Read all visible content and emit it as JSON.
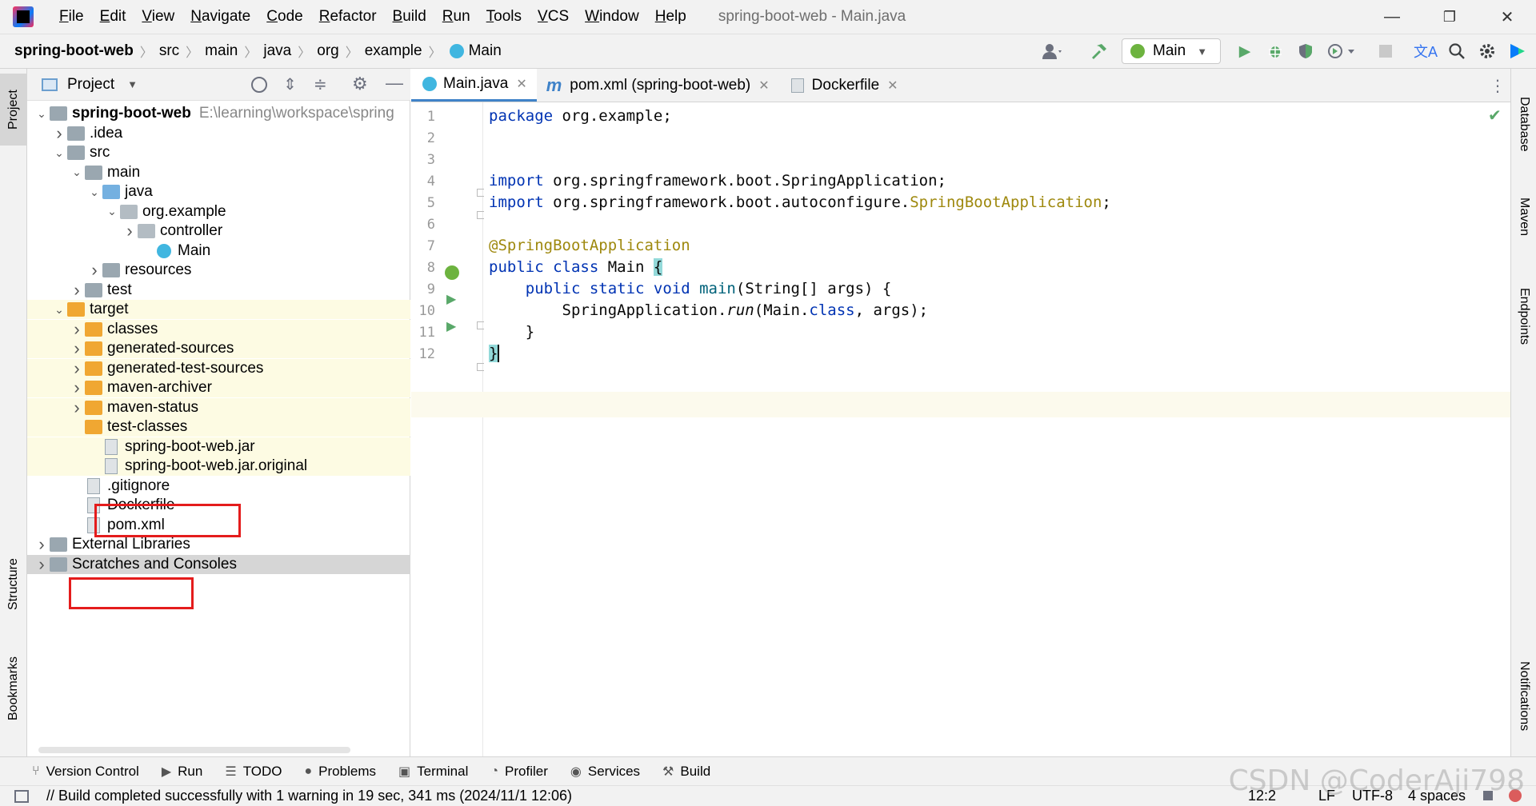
{
  "window": {
    "title": "spring-boot-web - Main.java",
    "minimize": "—",
    "restore": "❐",
    "close": "✕"
  },
  "menu": [
    "File",
    "Edit",
    "View",
    "Navigate",
    "Code",
    "Refactor",
    "Build",
    "Run",
    "Tools",
    "VCS",
    "Window",
    "Help"
  ],
  "breadcrumbs": [
    "spring-boot-web",
    "src",
    "main",
    "java",
    "org",
    "example",
    "Main"
  ],
  "run_config": {
    "label": "Main"
  },
  "project_panel": {
    "title": "Project"
  },
  "tree": [
    {
      "label": "spring-boot-web",
      "path": "E:\\learning\\workspace\\spring",
      "depth": 0,
      "chev": "v",
      "icon": "folder",
      "bold": true
    },
    {
      "label": ".idea",
      "depth": 1,
      "chev": ">",
      "icon": "folder"
    },
    {
      "label": "src",
      "depth": 1,
      "chev": "v",
      "icon": "folder"
    },
    {
      "label": "main",
      "depth": 2,
      "chev": "v",
      "icon": "folder"
    },
    {
      "label": "java",
      "depth": 3,
      "chev": "v",
      "icon": "folder-blue"
    },
    {
      "label": "org.example",
      "depth": 4,
      "chev": "v",
      "icon": "package"
    },
    {
      "label": "controller",
      "depth": 5,
      "chev": ">",
      "icon": "package"
    },
    {
      "label": "Main",
      "depth": 6,
      "chev": "",
      "icon": "class"
    },
    {
      "label": "resources",
      "depth": 3,
      "chev": ">",
      "icon": "folder"
    },
    {
      "label": "test",
      "depth": 2,
      "chev": ">",
      "icon": "folder"
    },
    {
      "label": "target",
      "depth": 1,
      "chev": "v",
      "icon": "folder-orange",
      "tgt": true
    },
    {
      "label": "classes",
      "depth": 2,
      "chev": ">",
      "icon": "folder-orange",
      "tgt": true
    },
    {
      "label": "generated-sources",
      "depth": 2,
      "chev": ">",
      "icon": "folder-orange",
      "tgt": true
    },
    {
      "label": "generated-test-sources",
      "depth": 2,
      "chev": ">",
      "icon": "folder-orange",
      "tgt": true
    },
    {
      "label": "maven-archiver",
      "depth": 2,
      "chev": ">",
      "icon": "folder-orange",
      "tgt": true
    },
    {
      "label": "maven-status",
      "depth": 2,
      "chev": ">",
      "icon": "folder-orange",
      "tgt": true
    },
    {
      "label": "test-classes",
      "depth": 2,
      "chev": "",
      "icon": "folder-orange",
      "tgt": true
    },
    {
      "label": "spring-boot-web.jar",
      "depth": 3,
      "chev": "",
      "icon": "file",
      "tgt": true
    },
    {
      "label": "spring-boot-web.jar.original",
      "depth": 3,
      "chev": "",
      "icon": "file",
      "tgt": true
    },
    {
      "label": ".gitignore",
      "depth": 2,
      "chev": "",
      "icon": "file"
    },
    {
      "label": "Dockerfile",
      "depth": 2,
      "chev": "",
      "icon": "file"
    },
    {
      "label": "pom.xml",
      "depth": 2,
      "chev": "",
      "icon": "file"
    },
    {
      "label": "External Libraries",
      "depth": 0,
      "chev": ">",
      "icon": "folder"
    },
    {
      "label": "Scratches and Consoles",
      "depth": 0,
      "chev": ">",
      "icon": "folder",
      "sel": true
    }
  ],
  "editor_tabs": [
    {
      "label": "Main.java",
      "active": true
    },
    {
      "label": "pom.xml (spring-boot-web)",
      "active": false
    },
    {
      "label": "Dockerfile",
      "active": false
    }
  ],
  "code": {
    "line_numbers": [
      "1",
      "2",
      "3",
      "4",
      "5",
      "6",
      "7",
      "8",
      "9",
      "10",
      "11",
      "12"
    ],
    "l1_kw": "package",
    "l1_rest": " org.example;",
    "l4_kw": "import",
    "l4_rest": " org.springframework.boot.SpringApplication;",
    "l5_kw": "import",
    "l5_rest": " org.springframework.boot.autoconfigure.",
    "l5_ann": "SpringBootApplication",
    "l5_end": ";",
    "l7_ann": "@SpringBootApplication",
    "l8_kw": "public class",
    "l8_rest": " Main ",
    "l8_brace": "{",
    "l9_indent": "    ",
    "l9_kw": "public static void",
    "l9_name": " main",
    "l9_rest": "(String[] args) {",
    "l10_indent": "        ",
    "l10_a": "SpringApplication.",
    "l10_run": "run",
    "l10_b": "(Main.",
    "l10_kw": "class",
    "l10_c": ", args);",
    "l11": "    }",
    "l12": "}"
  },
  "left_tabs": [
    "Project",
    "Structure",
    "Bookmarks"
  ],
  "right_tabs": [
    "Database",
    "Maven",
    "Endpoints",
    "Notifications"
  ],
  "tool_windows": [
    {
      "label": "Version Control",
      "glyph": "⑂"
    },
    {
      "label": "Run",
      "glyph": "▶"
    },
    {
      "label": "TODO",
      "glyph": "☰"
    },
    {
      "label": "Problems",
      "glyph": "●"
    },
    {
      "label": "Terminal",
      "glyph": "▣"
    },
    {
      "label": "Profiler",
      "glyph": "◔"
    },
    {
      "label": "Services",
      "glyph": "◉"
    },
    {
      "label": "Build",
      "glyph": "⚒"
    }
  ],
  "status": {
    "message": "// Build completed successfully with 1 warning in 19 sec, 341 ms (2024/11/1 12:06)",
    "position": "12:2",
    "line_sep": "LF",
    "encoding": "UTF-8",
    "indent": "4 spaces"
  },
  "watermark": "CSDN @CoderAji798"
}
